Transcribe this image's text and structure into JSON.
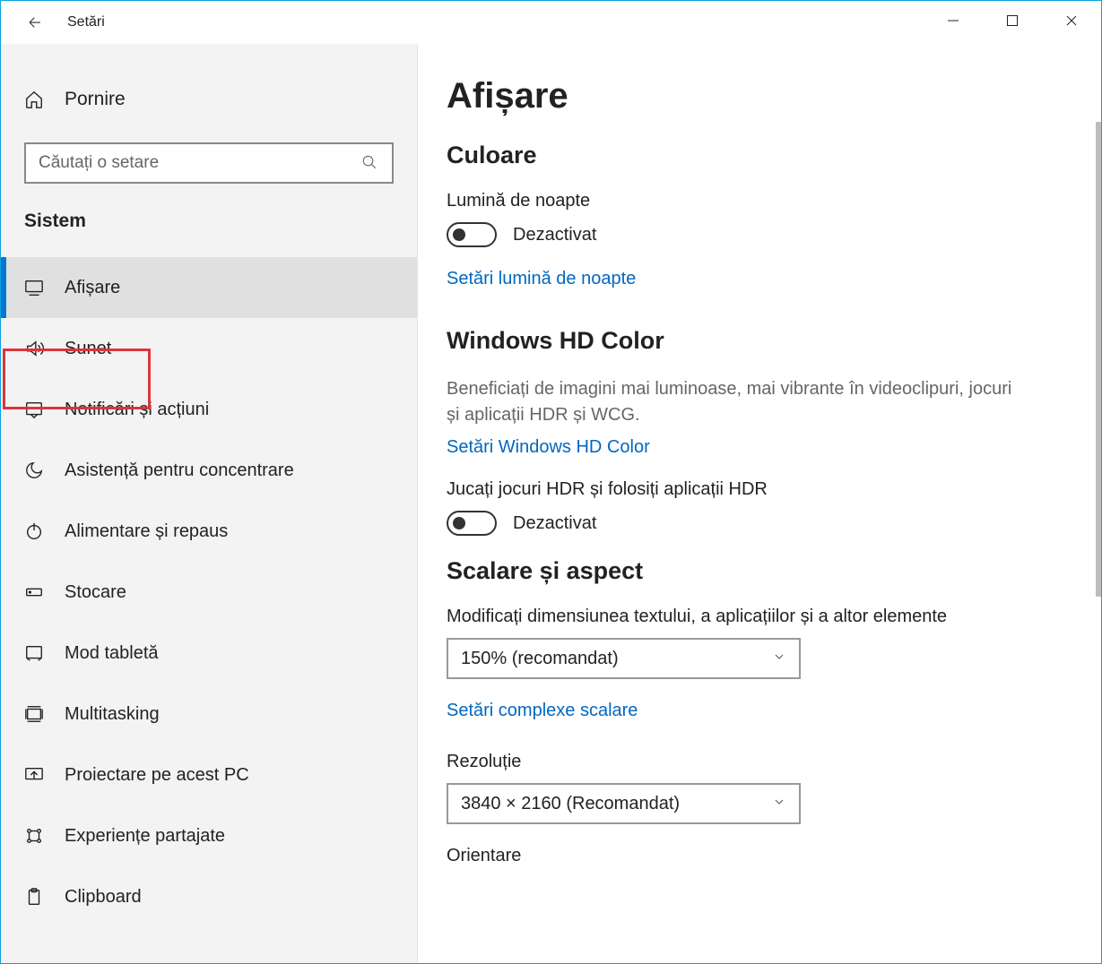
{
  "window": {
    "title": "Setări"
  },
  "sidebar": {
    "home_label": "Pornire",
    "search_placeholder": "Căutați o setare",
    "section_label": "Sistem",
    "items": [
      {
        "label": "Afișare",
        "icon": "display-icon",
        "active": true
      },
      {
        "label": "Sunet",
        "icon": "sound-icon"
      },
      {
        "label": "Notificări și acțiuni",
        "icon": "notifications-icon"
      },
      {
        "label": "Asistență pentru concentrare",
        "icon": "focus-assist-icon"
      },
      {
        "label": "Alimentare și repaus",
        "icon": "power-icon"
      },
      {
        "label": "Stocare",
        "icon": "storage-icon"
      },
      {
        "label": "Mod tabletă",
        "icon": "tablet-mode-icon"
      },
      {
        "label": "Multitasking",
        "icon": "multitasking-icon"
      },
      {
        "label": "Proiectare pe acest PC",
        "icon": "project-icon"
      },
      {
        "label": "Experiențe partajate",
        "icon": "shared-icon"
      },
      {
        "label": "Clipboard",
        "icon": "clipboard-icon"
      }
    ]
  },
  "main": {
    "page_title": "Afișare",
    "color": {
      "section_title": "Culoare",
      "night_light_label": "Lumină de noapte",
      "night_light_state": "Dezactivat",
      "night_light_link": "Setări lumină de noapte"
    },
    "hd": {
      "section_title": "Windows HD Color",
      "desc": "Beneficiați de imagini mai luminoase, mai vibrante în videoclipuri, jocuri și aplicații HDR și WCG.",
      "link": "Setări Windows HD Color",
      "hdr_label": "Jucați jocuri HDR și folosiți aplicații HDR",
      "hdr_state": "Dezactivat"
    },
    "scale": {
      "section_title": "Scalare și aspect",
      "scale_label": "Modificați dimensiunea textului, a aplicațiilor și a altor elemente",
      "scale_value": "150% (recomandat)",
      "scale_link": "Setări complexe scalare",
      "resolution_label": "Rezoluție",
      "resolution_value": "3840 × 2160 (Recomandat)",
      "orientation_label": "Orientare"
    }
  }
}
